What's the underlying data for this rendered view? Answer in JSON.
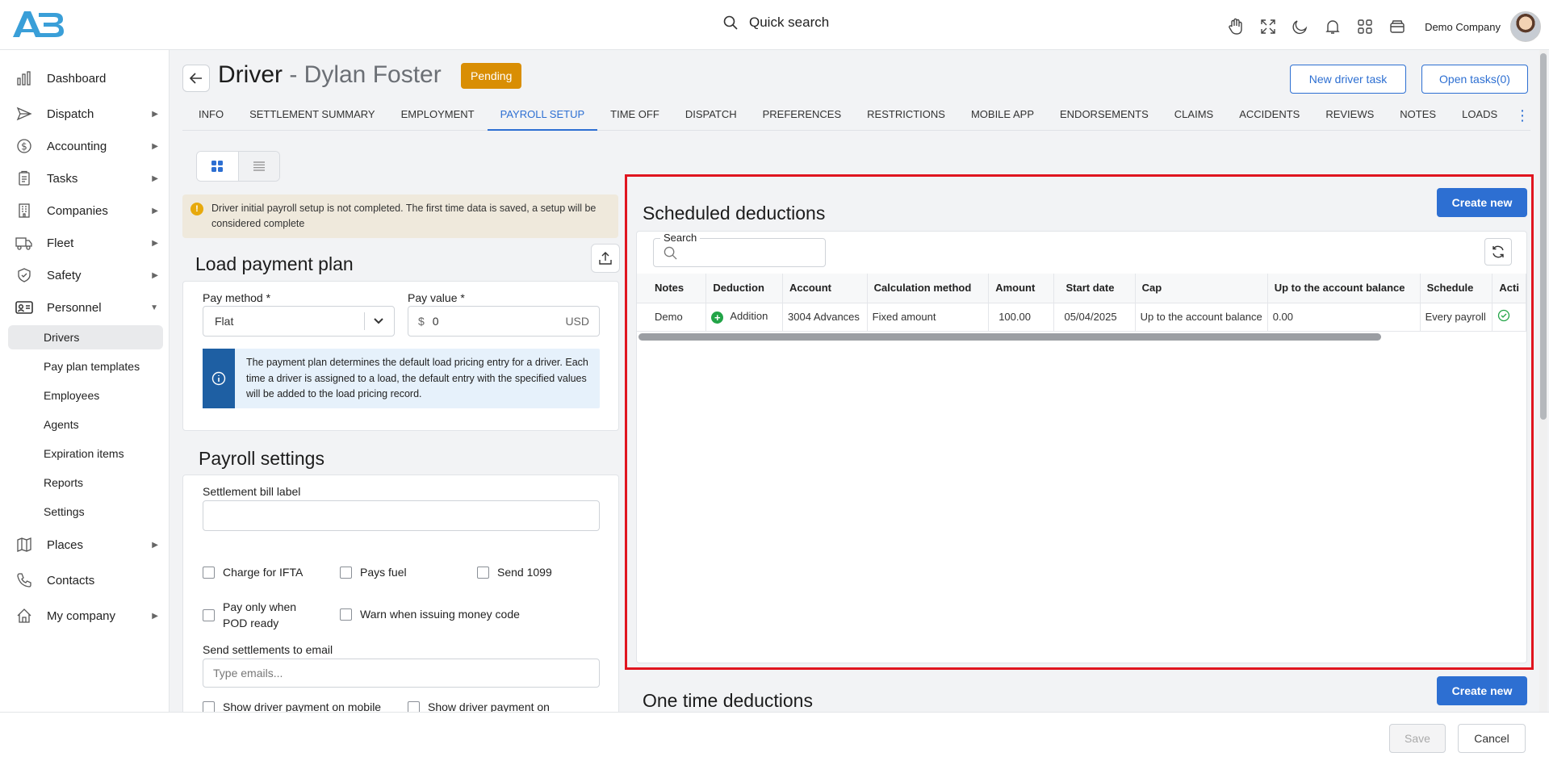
{
  "header": {
    "search_label": "Quick search",
    "company": "Demo Company",
    "icons": [
      "hand-icon",
      "fullscreen-icon",
      "moon-icon",
      "bell-icon",
      "apps-grid-icon",
      "wallet-icon"
    ]
  },
  "sidebar": {
    "items": [
      {
        "label": "Dashboard"
      },
      {
        "label": "Dispatch"
      },
      {
        "label": "Accounting"
      },
      {
        "label": "Tasks"
      },
      {
        "label": "Companies"
      },
      {
        "label": "Fleet"
      },
      {
        "label": "Safety"
      },
      {
        "label": "Personnel"
      },
      {
        "label": "Places"
      },
      {
        "label": "Contacts"
      },
      {
        "label": "My company"
      }
    ],
    "personnel_sub": [
      "Drivers",
      "Pay plan templates",
      "Employees",
      "Agents",
      "Expiration items",
      "Reports",
      "Settings"
    ]
  },
  "page": {
    "title_prefix": "Driver",
    "title_name": "- Dylan Foster",
    "status": "Pending",
    "new_task_label": "New driver task",
    "open_tasks_label": "Open tasks(0)"
  },
  "tabs": [
    "INFO",
    "SETTLEMENT SUMMARY",
    "EMPLOYMENT",
    "PAYROLL SETUP",
    "TIME OFF",
    "DISPATCH",
    "PREFERENCES",
    "RESTRICTIONS",
    "MOBILE APP",
    "ENDORSEMENTS",
    "CLAIMS",
    "ACCIDENTS",
    "REVIEWS",
    "NOTES",
    "LOADS"
  ],
  "warning": "Driver initial payroll setup is not completed. The first time data is saved, a setup will be considered complete",
  "load_plan": {
    "title": "Load payment plan",
    "pay_method_label": "Pay method *",
    "pay_method_value": "Flat",
    "pay_value_label": "Pay value *",
    "currency_symbol": "$",
    "pay_value": "0",
    "currency": "USD",
    "info": "The payment plan determines the default load pricing entry for a driver. Each time a driver is assigned to a load, the default entry with the specified values will be added to the load pricing record."
  },
  "payroll_settings": {
    "title": "Payroll settings",
    "bill_label_label": "Settlement bill label",
    "bill_label_value": "",
    "checkboxes": {
      "ifta": "Charge for IFTA",
      "fuel": "Pays fuel",
      "send1099": "Send 1099",
      "pod_line1": "Pay only when",
      "pod_line2": "POD ready",
      "money_code": "Warn when issuing money code",
      "mobile_a": "Show driver payment on mobile",
      "mobile_b": "Show driver payment on"
    },
    "email_label": "Send settlements to email",
    "email_placeholder": "Type emails..."
  },
  "scheduled": {
    "title": "Scheduled deductions",
    "create_label": "Create new",
    "search_label": "Search",
    "columns": [
      "Notes",
      "Deduction",
      "Account",
      "Calculation method",
      "Amount",
      "Start date",
      "Cap",
      "Up to the account balance",
      "Schedule",
      "Acti"
    ],
    "rows": [
      {
        "notes": "Demo",
        "deduction": "Addition",
        "account": "3004 Advances",
        "method": "Fixed amount",
        "amount": "100.00",
        "start": "05/04/2025",
        "cap": "Up to the account balance",
        "balance": "0.00",
        "schedule": "Every payroll"
      }
    ]
  },
  "one_time": {
    "title": "One time deductions",
    "create_label": "Create new"
  },
  "footer": {
    "save": "Save",
    "cancel": "Cancel"
  },
  "colors": {
    "accent": "#2d6fd2",
    "pending": "#d98e04",
    "highlight_border": "#e0151f",
    "addition": "#22a447"
  }
}
